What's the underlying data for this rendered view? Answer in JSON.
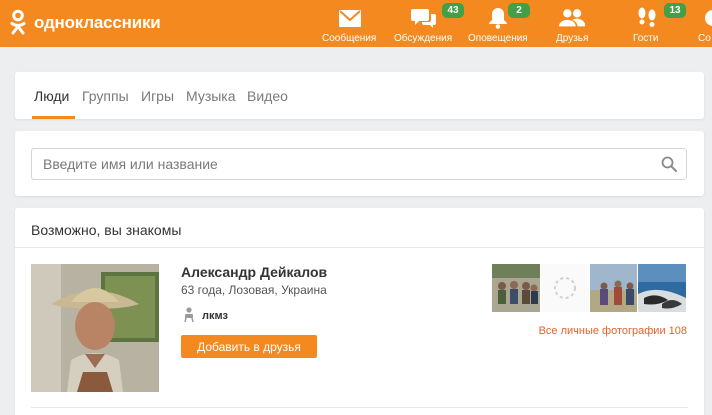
{
  "brand": {
    "name": "одноклассники",
    "color": "#f48a1f"
  },
  "nav": [
    {
      "label": "Сообщения",
      "icon": "envelope-icon",
      "badge": ""
    },
    {
      "label": "Обсуждения",
      "icon": "chat-bubbles-icon",
      "badge": "43"
    },
    {
      "label": "Оповещения",
      "icon": "bell-icon",
      "badge": "2"
    },
    {
      "label": "Друзья",
      "icon": "friends-icon",
      "badge": ""
    },
    {
      "label": "Гости",
      "icon": "footprints-icon",
      "badge": "13"
    },
    {
      "label": "Со",
      "icon": "partial-icon",
      "badge": ""
    }
  ],
  "tabs": [
    {
      "label": "Люди",
      "active": true
    },
    {
      "label": "Группы",
      "active": false
    },
    {
      "label": "Игры",
      "active": false
    },
    {
      "label": "Музыка",
      "active": false
    },
    {
      "label": "Видео",
      "active": false
    }
  ],
  "search": {
    "placeholder": "Введите имя или название"
  },
  "suggestions": {
    "title": "Возможно, вы знакомы",
    "person": {
      "name": "Александр Дейкалов",
      "info": "63 года, Лозовая, Украина",
      "work": "лкмз",
      "add_label": "Добавить в друзья"
    },
    "all_photos_label": "Все личные фотографии 108"
  },
  "colors": {
    "badge": "#43a047",
    "link": "#e3632e"
  }
}
